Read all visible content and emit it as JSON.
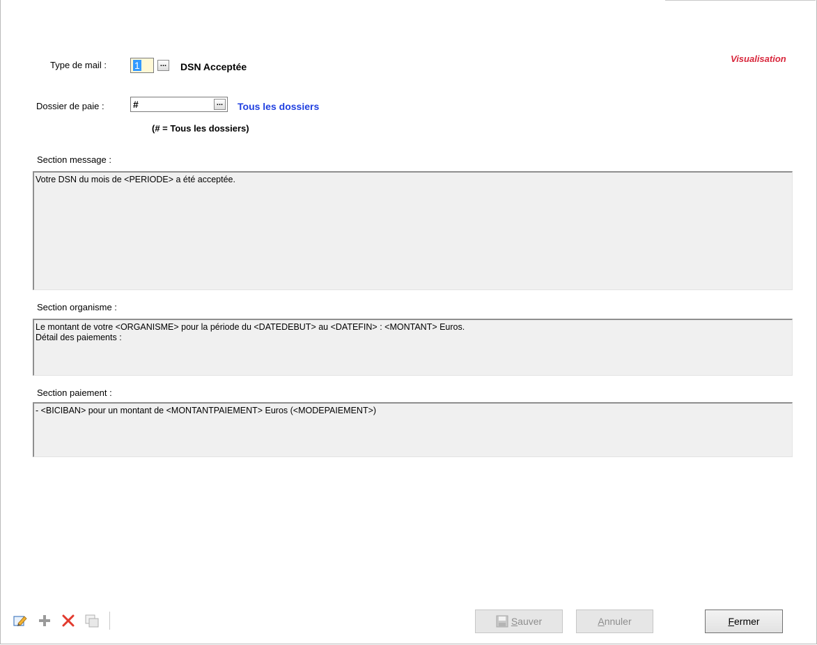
{
  "form": {
    "type_label": "Type de mail :",
    "type_value": "1",
    "type_desc": "DSN Acceptée",
    "mode": "Visualisation",
    "dossier_label": "Dossier de paie :",
    "dossier_value": "#",
    "dossier_desc": "Tous les dossiers",
    "dossier_hint": "(# = Tous les dossiers)",
    "message_label": "Section message :",
    "message_text": "Votre DSN du mois de <PERIODE> a été acceptée.",
    "organisme_label": "Section organisme :",
    "organisme_text": "Le montant de votre <ORGANISME> pour la période du <DATEDEBUT> au <DATEFIN> : <MONTANT> Euros.\nDétail des paiements :",
    "paiement_label": "Section paiement :",
    "paiement_text": "- <BICIBAN> pour un montant de <MONTANTPAIEMENT> Euros (<MODEPAIEMENT>)"
  },
  "buttons": {
    "save_first": "S",
    "save_rest": "auver",
    "cancel_first": "A",
    "cancel_rest": "nnuler",
    "close_first": "F",
    "close_rest": "ermer"
  },
  "toolbar": {
    "icons": [
      "edit-icon",
      "add-icon",
      "delete-icon",
      "duplicate-icon"
    ]
  },
  "colors": {
    "mode": "#d8263b",
    "link": "#1f3fe0",
    "area_bg": "#f0f0f0",
    "selection": "#3399ff"
  }
}
